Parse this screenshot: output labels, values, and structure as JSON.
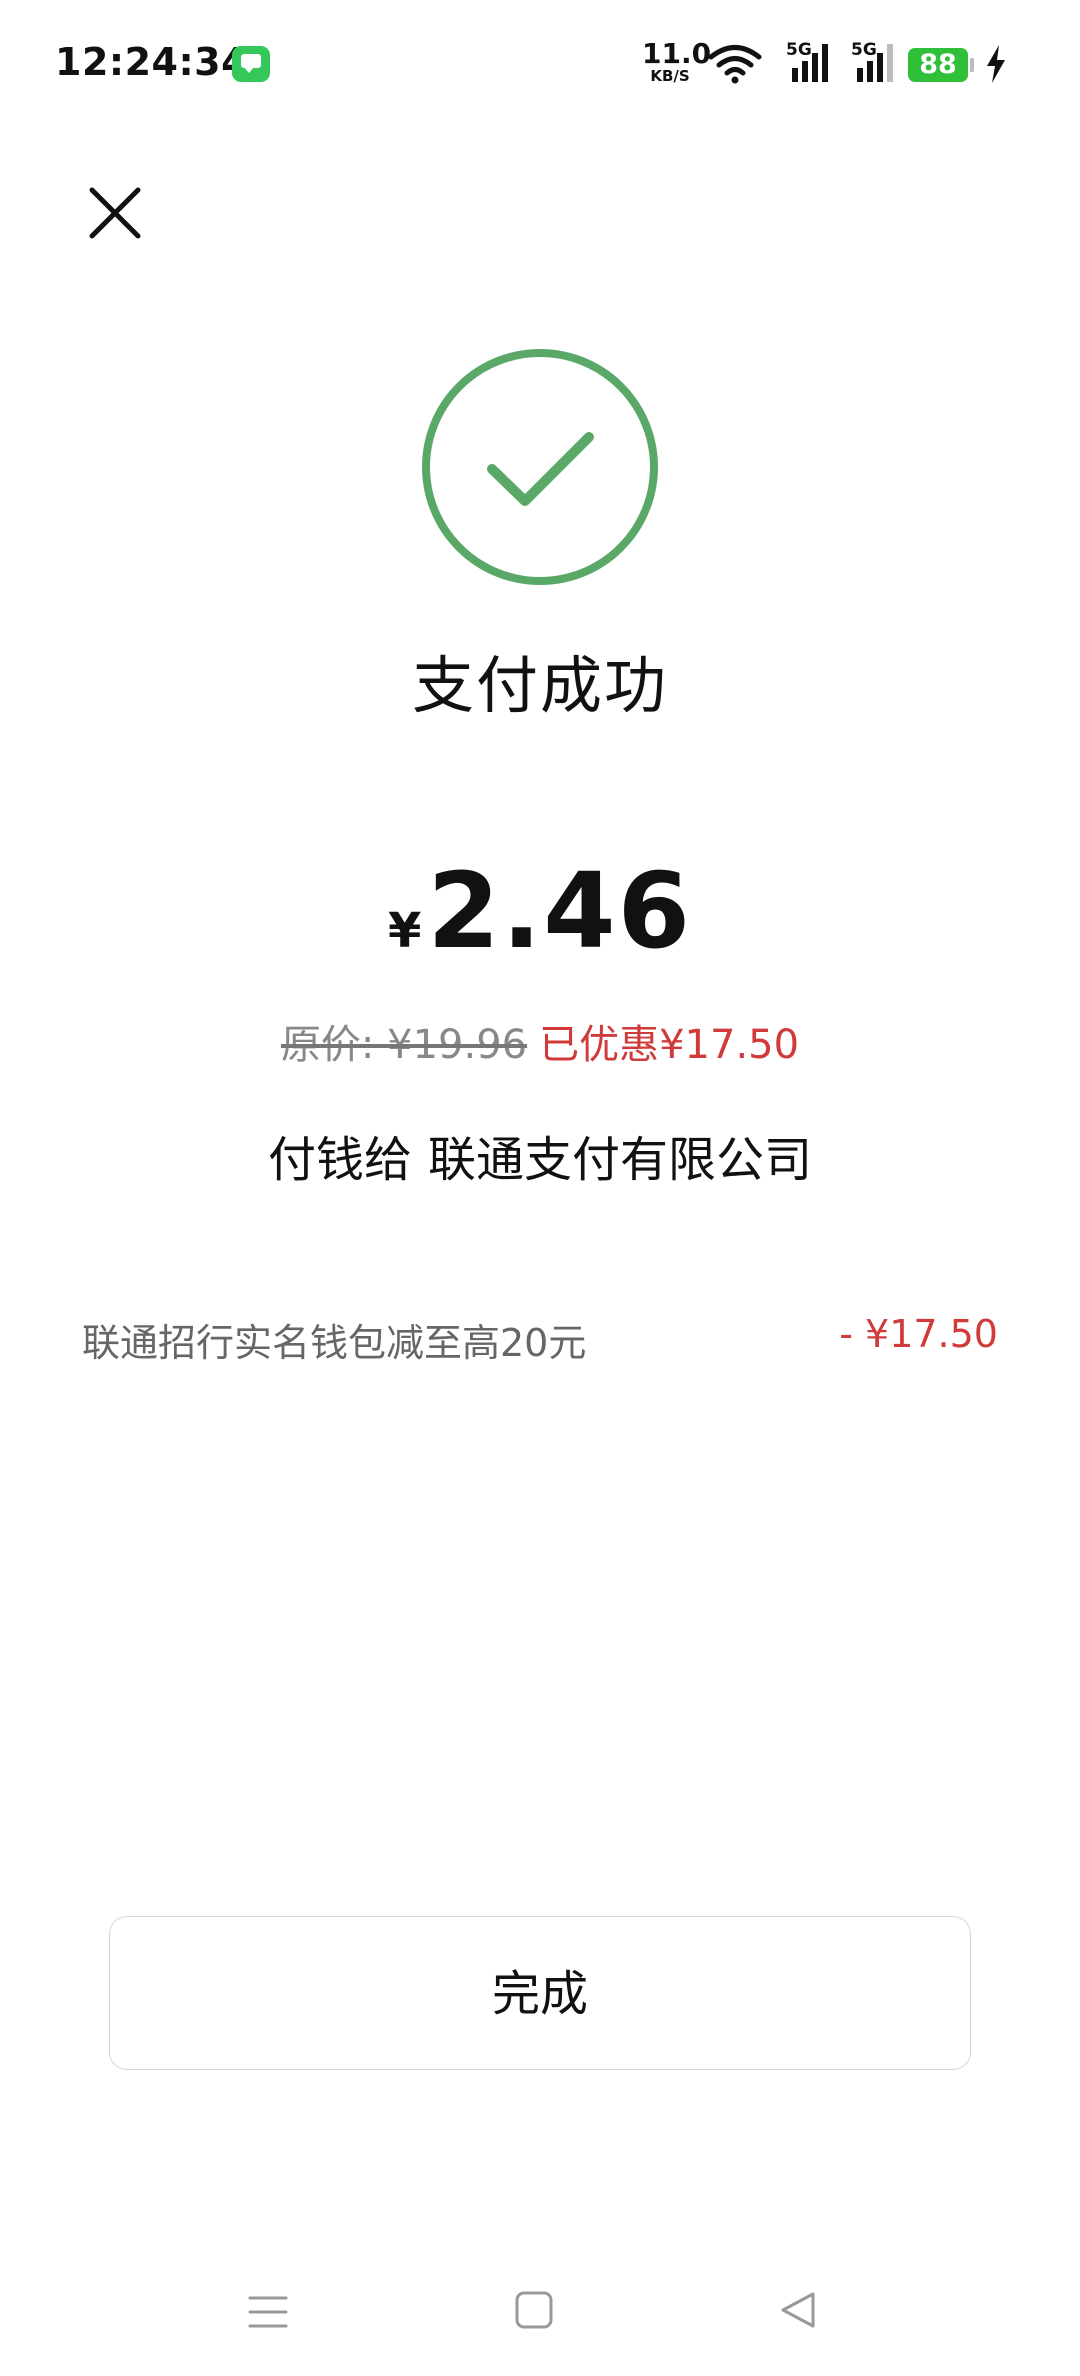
{
  "status_bar": {
    "time": "12:24:34",
    "net_speed_value": "11.0",
    "net_speed_unit": "KB/S",
    "sim1_label": "5G",
    "sim2_label": "5G",
    "battery_level": "88",
    "icons": [
      "message-app-icon",
      "wifi-icon",
      "signal-icon",
      "signal-icon",
      "battery-icon",
      "charging-icon"
    ]
  },
  "header": {
    "close_icon": "close-icon"
  },
  "result": {
    "icon": "check-circle-icon",
    "accent_color": "#5aa867",
    "title": "支付成功",
    "currency_symbol": "¥",
    "amount": "2.46",
    "original_price": "原价: ¥19.96",
    "discount_text": "已优惠¥17.50",
    "payee_prefix": "付钱给",
    "payee_name": "联通支付有限公司"
  },
  "promotion": {
    "label": "联通招行实名钱包减至高20元",
    "amount": "- ¥17.50",
    "discount_color": "#d03a3a"
  },
  "actions": {
    "done_label": "完成"
  },
  "navigation_bar": {
    "icons": [
      "menu-icon",
      "home-icon",
      "back-icon"
    ]
  }
}
